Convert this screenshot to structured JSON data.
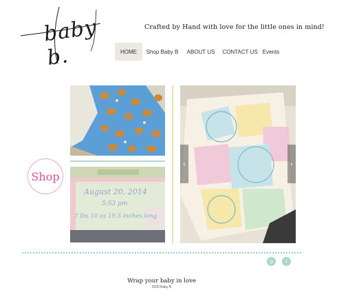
{
  "brand": {
    "logo_text": "baby b."
  },
  "header": {
    "tagline": "Crafted by Hand with love for the little ones in mind!"
  },
  "nav": {
    "items": [
      {
        "label": "HOME",
        "active": true
      },
      {
        "label": "Shop Baby B",
        "active": false
      },
      {
        "label": "ABOUT US",
        "active": false
      },
      {
        "label": "CONTACT US",
        "active": false
      },
      {
        "label": "Events",
        "active": false
      }
    ]
  },
  "gallery": {
    "blanket_embroidery": {
      "line1": "August 20, 2014",
      "line2": "5:53 pm",
      "line3": "7 lbs 10 oz    19.5 inches long"
    },
    "prev_icon": "chevron-left-icon",
    "next_icon": "chevron-right-icon"
  },
  "shop_link": {
    "label": "Shop"
  },
  "social": [
    {
      "icon": "social-icon",
      "glyph": "◎"
    },
    {
      "icon": "facebook-icon",
      "glyph": "f"
    }
  ],
  "footer": {
    "slogan": "Wrap your baby in love",
    "copyright": "2020 Baby B"
  },
  "colors": {
    "accent_pink": "#e04d9c",
    "accent_mint": "#8fd0be",
    "nav_active_bg": "#ece8e2"
  }
}
